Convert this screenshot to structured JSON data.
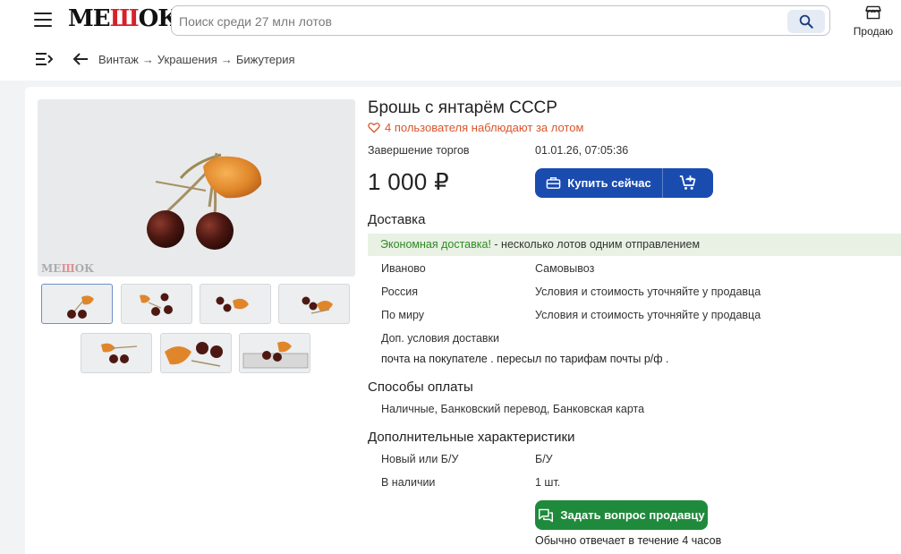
{
  "header": {
    "logo_text": "МЕШОК",
    "logo_accent": "Ш",
    "search_placeholder": "Поиск среди 27 млн лотов",
    "search_value": "",
    "sell_label": "Продаю"
  },
  "breadcrumbs": [
    "Винтаж",
    "Украшения",
    "Бижутерия"
  ],
  "lot": {
    "title": "Брошь с янтарём СССР",
    "watchers": "4 пользователя наблюдают за лотом",
    "end_label": "Завершение торгов",
    "end_value": "01.01.26, 07:05:36",
    "price": "1 000 ₽",
    "buy_now": "Купить сейчас"
  },
  "delivery": {
    "heading": "Доставка",
    "promo_highlight": "Экономная доставка!",
    "promo_text": " - несколько лотов одним отправлением",
    "rows": [
      {
        "label": "Иваново",
        "value": "Самовывоз"
      },
      {
        "label": "Россия",
        "value": "Условия и стоимость уточняйте у продавца"
      },
      {
        "label": "По миру",
        "value": "Условия и стоимость уточняйте у продавца"
      }
    ],
    "extra_label": "Доп. условия доставки",
    "extra_note": "почта на покупателе . пересыл по тарифам почты р/ф ."
  },
  "payment": {
    "heading": "Способы оплаты",
    "methods": "Наличные, Банковский перевод, Банковская карта"
  },
  "characteristics": {
    "heading": "Дополнительные характеристики",
    "rows": [
      {
        "label": "Новый или Б/У",
        "value": "Б/У"
      },
      {
        "label": "В наличии",
        "value": "1 шт."
      }
    ]
  },
  "seller": {
    "ask_button": "Задать вопрос продавцу",
    "reply_time": "Обычно отвечает в течение 4 часов"
  },
  "colors": {
    "brand_blue": "#1a4cb0",
    "ask_green": "#1f8a3b",
    "watch_orange": "#d9562b",
    "promo_green": "#2e8b22",
    "logo_red": "#d6212b"
  }
}
